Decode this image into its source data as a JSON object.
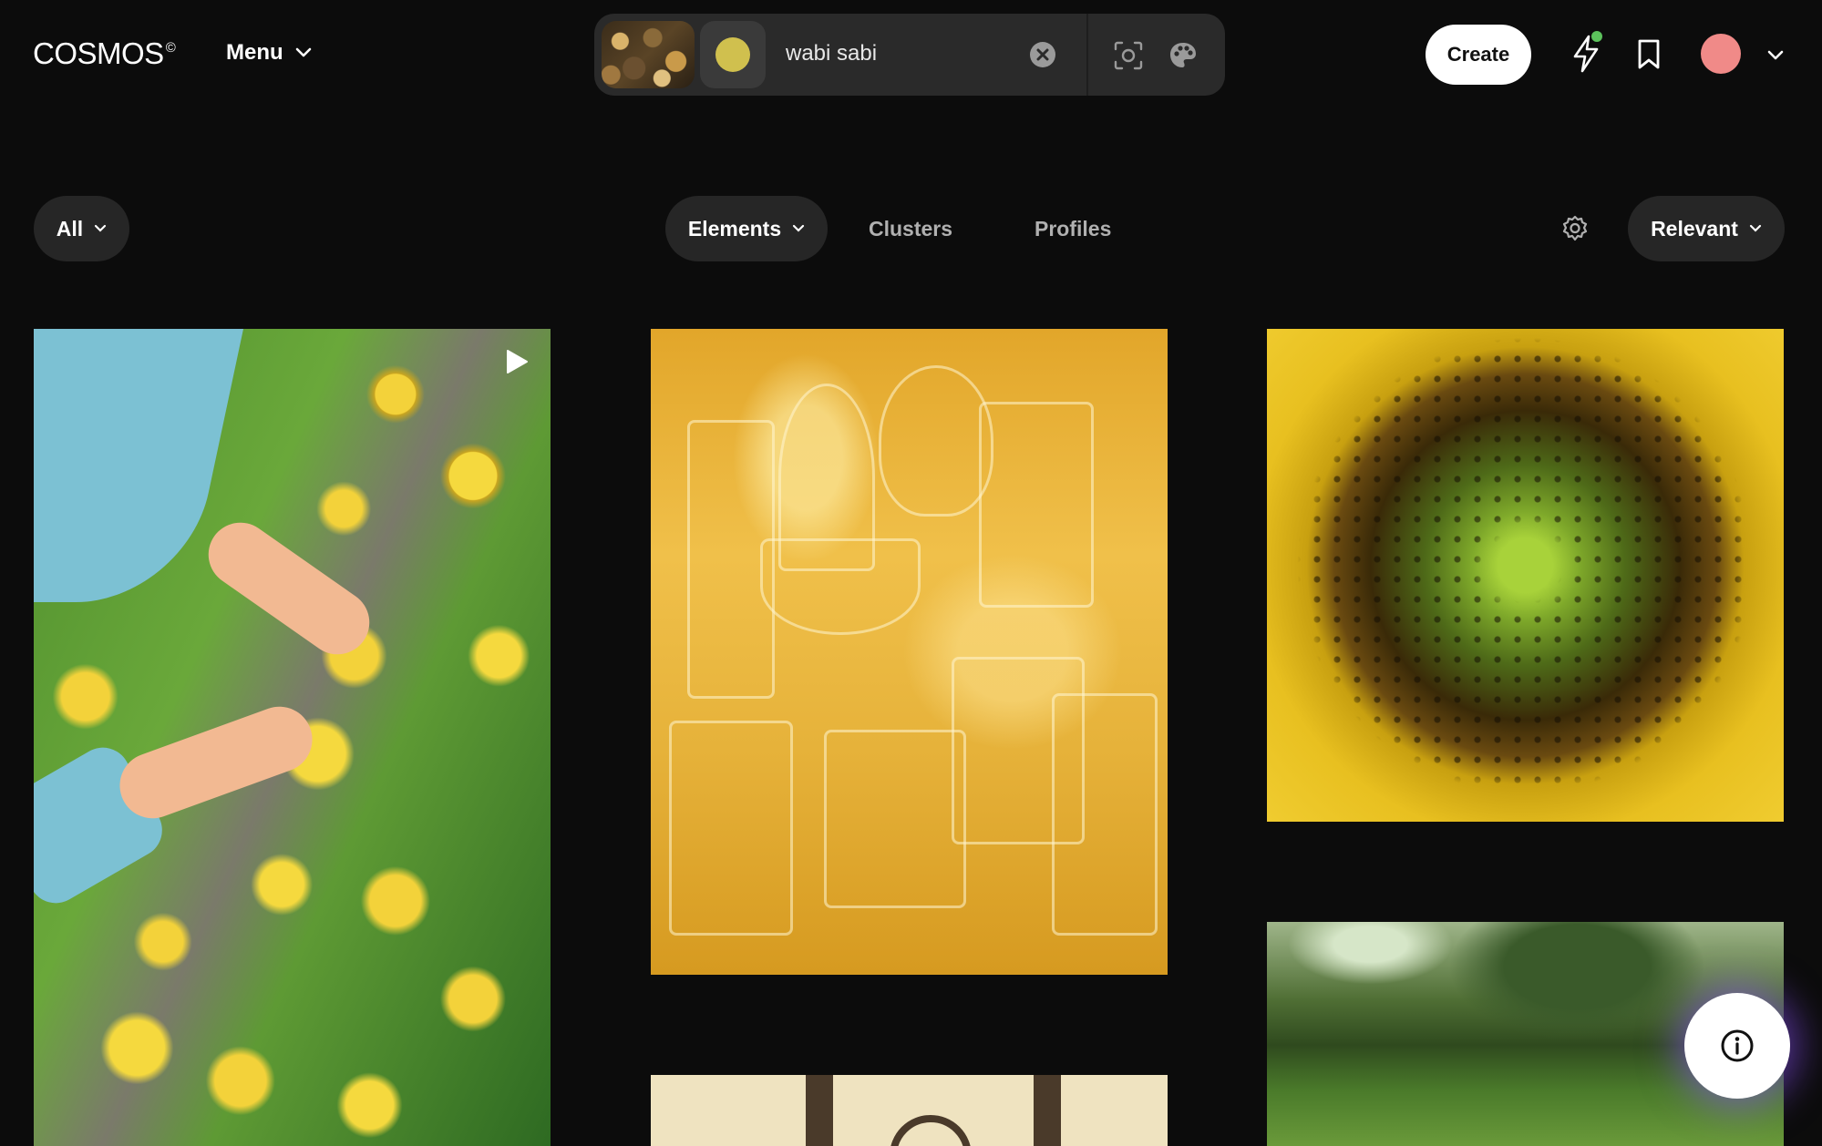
{
  "header": {
    "logo": "COSMOS",
    "logo_mark": "©",
    "menu_label": "Menu",
    "search": {
      "query": "wabi sabi",
      "swatch_color": "#d0c04e",
      "icons": [
        "image-thumbnail",
        "color-swatch",
        "clear-icon",
        "visual-search-icon",
        "palette-icon"
      ]
    },
    "create_label": "Create",
    "icons": [
      "lightning-icon",
      "bookmark-icon",
      "avatar",
      "chevron-down-icon"
    ],
    "notification_dot_color": "#5cc25c",
    "avatar_color": "#f08a88"
  },
  "filters": {
    "scope_label": "All",
    "tabs": [
      {
        "label": "Elements",
        "active": true
      },
      {
        "label": "Clusters",
        "active": false
      },
      {
        "label": "Profiles",
        "active": false
      }
    ],
    "sort_label": "Relevant"
  },
  "grid": {
    "items": [
      {
        "kind": "video",
        "subject": "hands picking yellow mushrooms"
      },
      {
        "kind": "image",
        "subject": "amber glassware"
      },
      {
        "kind": "image",
        "subject": "sunflower center"
      },
      {
        "kind": "image",
        "subject": "wooden arch"
      },
      {
        "kind": "image",
        "subject": "green garden"
      }
    ]
  },
  "colors": {
    "background": "#0c0c0c",
    "pill": "#262626",
    "search_bg": "#2a2a2a",
    "inactive_tab": "#b0b0b0"
  }
}
